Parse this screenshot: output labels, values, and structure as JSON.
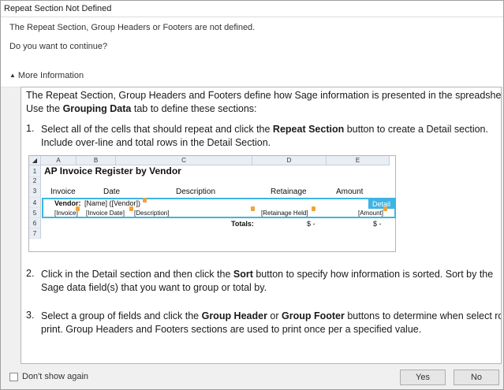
{
  "window": {
    "title": "Repeat Section Not Defined"
  },
  "message": {
    "line1": "The Repeat Section, Group Headers or Footers are not defined.",
    "line2": "Do you want to continue?",
    "more_info": "More Information"
  },
  "info": {
    "intro1": "The Repeat Section, Group Headers and Footers define how Sage information is presented in the spreadsheet.",
    "intro2_pre": "Use the ",
    "intro2_bold": "Grouping Data",
    "intro2_post": " tab to define these sections:",
    "step1_num": "1.",
    "step1_a": "Select all of the cells that should repeat and click the ",
    "step1_bold": "Repeat Section",
    "step1_b": " button to create a Detail section.",
    "step1_c": "Include over-line and total rows in the Detail Section.",
    "step2_num": "2.",
    "step2_a": "Click in the Detail section and then click the ",
    "step2_bold": "Sort",
    "step2_b": " button to specify how information is sorted. Sort by the",
    "step2_c": "Sage data field(s) that you want to group or total by.",
    "step3_num": "3.",
    "step3_a": "Select a group of fields and click the ",
    "step3_bold1": "Group Header",
    "step3_mid": " or ",
    "step3_bold2": "Group Footer",
    "step3_b": " buttons to determine when select rows",
    "step3_c": "print. Group Headers and Footers sections are used to print once per a specified value."
  },
  "sheet": {
    "columns": [
      "A",
      "B",
      "C",
      "D",
      "E"
    ],
    "rows": [
      "1",
      "2",
      "3",
      "4",
      "5",
      "6",
      "7"
    ],
    "title": "AP Invoice Register by Vendor",
    "headers": {
      "invoice": "Invoice",
      "date": "Date",
      "description": "Description",
      "retainage": "Retainage",
      "amount": "Amount"
    },
    "vendor_label": "Vendor:",
    "vendor_value": "[Name] ([Vendor])",
    "detail_tag": "Detail",
    "row5": {
      "invoice": "[Invoice]",
      "date": "[Invoice Date]",
      "description": "[Description]",
      "retainage": "[Retainage Held]",
      "amount": "[Amount]"
    },
    "totals_label": "Totals:",
    "total_retainage": "$ -",
    "total_amount": "$ -"
  },
  "footer": {
    "dont_show": "Don't show again",
    "yes": "Yes",
    "no": "No"
  }
}
